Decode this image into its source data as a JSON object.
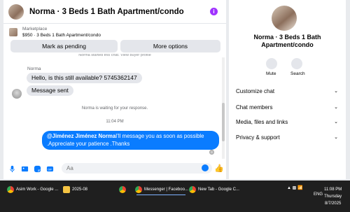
{
  "chat": {
    "title": "Norma · 3 Beds 1 Bath Apartment/condo",
    "listing_label": "Marketplace",
    "listing_detail": "$950 · 3 Beds 1 Bath Apartment/condo",
    "pending_btn": "Mark as pending",
    "more_btn": "More options",
    "clip_note": "Norma started this chat. View buyer profile",
    "sender": "Norma",
    "msg_in_1": "Hello, is this still available? 5745362147",
    "msg_in_2": "Message sent",
    "waiting_text": "Norma is waiting for your response.",
    "time": "11:04 PM",
    "msg_out_mention": "@Jiménez Jiménez Norma",
    "msg_out_rest": "I'll message you as soon as possible .Appreciate your patience .Thanks",
    "input_placeholder": "Aa"
  },
  "info": {
    "name": "Norma · 3 Beds 1 Bath Apartment/condo",
    "mute": "Mute",
    "search": "Search",
    "rows": [
      "Customize chat",
      "Chat members",
      "Media, files and links",
      "Privacy & support"
    ]
  },
  "taskbar": {
    "items": [
      "Asim Work - Google ...",
      "2025-08",
      "Messenger | Faceboo...",
      "New Tab - Google C..."
    ],
    "lang": "ENG",
    "time": "11:08 PM",
    "day": "Thursday",
    "date": "8/7/2025"
  },
  "colors": {
    "accent": "#0a7cff",
    "badge": "#a033ff",
    "taskbar": "#1f1f1f"
  }
}
